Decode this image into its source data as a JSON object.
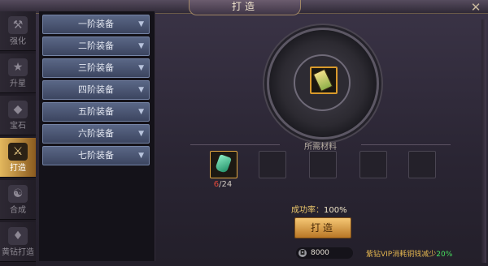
{
  "window": {
    "title": "打造",
    "close_icon": "close-icon"
  },
  "tabs": [
    {
      "label": "强化",
      "icon": "enhance-icon",
      "active": false
    },
    {
      "label": "升星",
      "icon": "star-icon",
      "active": false
    },
    {
      "label": "宝石",
      "icon": "gem-icon",
      "active": false
    },
    {
      "label": "打造",
      "icon": "anvil-icon",
      "active": true
    },
    {
      "label": "合成",
      "icon": "synthesis-icon",
      "active": false
    },
    {
      "label": "黄钻打造",
      "icon": "diamond-icon",
      "active": false
    }
  ],
  "categories": [
    {
      "label": "一阶装备"
    },
    {
      "label": "二阶装备"
    },
    {
      "label": "三阶装备"
    },
    {
      "label": "四阶装备"
    },
    {
      "label": "五阶装备"
    },
    {
      "label": "六阶装备"
    },
    {
      "label": "七阶装备"
    }
  ],
  "forge": {
    "materials_header": "所需材料",
    "material_current": "6",
    "material_total": "/24",
    "success_label": "成功率：",
    "success_value": "100%",
    "button_label": "打造",
    "cost_amount": "8000",
    "vip_text": "紫钻VIP消耗铜钱减少",
    "vip_percent": "20%"
  },
  "colors": {
    "accent_gold": "#e8c46a",
    "count_red": "#e0483a",
    "vip_green": "#47e05e"
  }
}
